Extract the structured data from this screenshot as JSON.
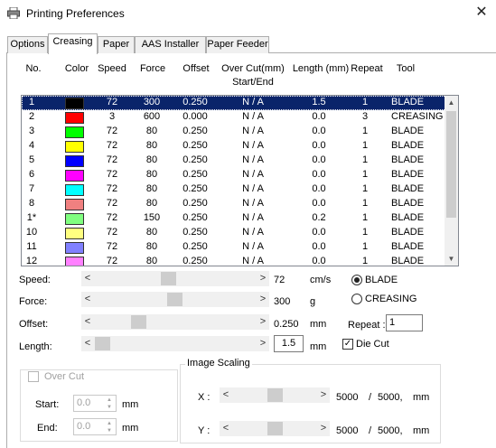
{
  "window": {
    "title": "Printing Preferences",
    "close": "✕"
  },
  "tabs": [
    "Options",
    "Creasing",
    "Paper",
    "AAS Installer",
    "Paper Feeder"
  ],
  "active_tab": "Creasing",
  "table": {
    "headers": {
      "no": "No.",
      "color": "Color",
      "speed": "Speed",
      "force": "Force",
      "offset": "Offset",
      "overcut": "Over Cut(mm)",
      "overcut2": "Start/End",
      "length": "Length (mm)",
      "repeat": "Repeat",
      "tool": "Tool"
    },
    "rows": [
      {
        "no": "1",
        "color": "#000000",
        "speed": "72",
        "force": "300",
        "offset": "0.250",
        "overcut": "N / A",
        "length": "1.5",
        "repeat": "1",
        "tool": "BLADE",
        "selected": true
      },
      {
        "no": "2",
        "color": "#ff0000",
        "speed": "3",
        "force": "600",
        "offset": "0.000",
        "overcut": "N / A",
        "length": "0.0",
        "repeat": "3",
        "tool": "CREASING"
      },
      {
        "no": "3",
        "color": "#00ff00",
        "speed": "72",
        "force": "80",
        "offset": "0.250",
        "overcut": "N / A",
        "length": "0.0",
        "repeat": "1",
        "tool": "BLADE"
      },
      {
        "no": "4",
        "color": "#ffff00",
        "speed": "72",
        "force": "80",
        "offset": "0.250",
        "overcut": "N / A",
        "length": "0.0",
        "repeat": "1",
        "tool": "BLADE"
      },
      {
        "no": "5",
        "color": "#0000ff",
        "speed": "72",
        "force": "80",
        "offset": "0.250",
        "overcut": "N / A",
        "length": "0.0",
        "repeat": "1",
        "tool": "BLADE"
      },
      {
        "no": "6",
        "color": "#ff00ff",
        "speed": "72",
        "force": "80",
        "offset": "0.250",
        "overcut": "N / A",
        "length": "0.0",
        "repeat": "1",
        "tool": "BLADE"
      },
      {
        "no": "7",
        "color": "#00ffff",
        "speed": "72",
        "force": "80",
        "offset": "0.250",
        "overcut": "N / A",
        "length": "0.0",
        "repeat": "1",
        "tool": "BLADE"
      },
      {
        "no": "8",
        "color": "#f08080",
        "speed": "72",
        "force": "80",
        "offset": "0.250",
        "overcut": "N / A",
        "length": "0.0",
        "repeat": "1",
        "tool": "BLADE"
      },
      {
        "no": "1*",
        "color": "#80ff80",
        "speed": "72",
        "force": "150",
        "offset": "0.250",
        "overcut": "N / A",
        "length": "0.2",
        "repeat": "1",
        "tool": "BLADE"
      },
      {
        "no": "10",
        "color": "#ffff80",
        "speed": "72",
        "force": "80",
        "offset": "0.250",
        "overcut": "N / A",
        "length": "0.0",
        "repeat": "1",
        "tool": "BLADE"
      },
      {
        "no": "11",
        "color": "#8080ff",
        "speed": "72",
        "force": "80",
        "offset": "0.250",
        "overcut": "N / A",
        "length": "0.0",
        "repeat": "1",
        "tool": "BLADE"
      },
      {
        "no": "12",
        "color": "#ff80ff",
        "speed": "72",
        "force": "80",
        "offset": "0.250",
        "overcut": "N / A",
        "length": "0.0",
        "repeat": "1",
        "tool": "BLADE"
      }
    ]
  },
  "controls": {
    "speed": {
      "label": "Speed:",
      "value": "72",
      "unit": "cm/s"
    },
    "force": {
      "label": "Force:",
      "value": "300",
      "unit": "g"
    },
    "offset": {
      "label": "Offset:",
      "value": "0.250",
      "unit": "mm"
    },
    "length": {
      "label": "Length:",
      "value": "1.5",
      "unit": "mm"
    },
    "tool_blade": "BLADE",
    "tool_creasing": "CREASING",
    "repeat_label": "Repeat :",
    "repeat_value": "1",
    "die_cut": "Die Cut"
  },
  "overcut": {
    "label": "Over Cut",
    "start_label": "Start:",
    "start_value": "0.0",
    "end_label": "End:",
    "end_value": "0.0",
    "unit": "mm"
  },
  "image_scaling": {
    "title": "Image Scaling",
    "x_label": "X :",
    "x_value": "5000",
    "x_sep": "/",
    "x_max": "5000,",
    "x_unit": "mm",
    "y_label": "Y :",
    "y_value": "5000",
    "y_sep": "/",
    "y_max": "5000,",
    "y_unit": "mm"
  },
  "glyphs": {
    "left": "<",
    "right": ">",
    "up": "▲",
    "down": "▼",
    "check": "✓"
  },
  "colors": {
    "selection": "#0a246a"
  }
}
